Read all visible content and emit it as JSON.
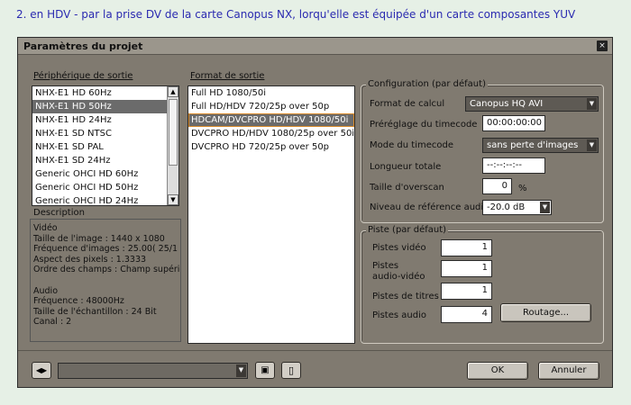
{
  "caption": "2. en HDV - par la prise DV de la carte Canopus NX, lorqu'elle est équipée d'un carte composantes YUV",
  "dialog": {
    "title": "Paramètres du projet",
    "close_glyph": "×"
  },
  "output_device": {
    "label": "Périphérique de sortie",
    "items": [
      {
        "label": "NHX-E1 HD 60Hz"
      },
      {
        "label": "NHX-E1 HD 50Hz"
      },
      {
        "label": "NHX-E1 HD 24Hz"
      },
      {
        "label": "NHX-E1 SD NTSC"
      },
      {
        "label": "NHX-E1 SD PAL"
      },
      {
        "label": "NHX-E1 SD 24Hz"
      },
      {
        "label": "Generic OHCI HD 60Hz"
      },
      {
        "label": "Generic OHCI HD 50Hz"
      },
      {
        "label": "Generic OHCI HD 24Hz"
      }
    ],
    "selected_index": 1
  },
  "output_format": {
    "label": "Format de sortie",
    "items": [
      {
        "label": "Full HD 1080/50i"
      },
      {
        "label": "Full HD/HDV 720/25p over 50p"
      },
      {
        "label": "HDCAM/DVCPRO HD/HDV 1080/50i"
      },
      {
        "label": "DVCPRO HD/HDV 1080/25p over 50i"
      },
      {
        "label": "DVCPRO HD 720/25p over 50p"
      }
    ],
    "selected_index": 2
  },
  "description": {
    "label": "Description",
    "lines": [
      "Vidéo",
      "Taille de l'image : 1440 x 1080",
      "Fréquence d'images : 25.00( 25/1",
      " Aspect des pixels : 1.3333",
      "Ordre des champs : Champ supérie",
      "",
      "Audio",
      "Fréquence : 48000Hz",
      "Taille de l'échantillon : 24 Bit",
      " Canal : 2"
    ]
  },
  "config": {
    "title": "Configuration (par défaut)",
    "format_calc_label": "Format de calcul",
    "format_calc_value": "Canopus HQ AVI",
    "timecode_preset_label": "Préréglage du timecode",
    "timecode_preset_value": "00:00:00:00",
    "timecode_mode_label": "Mode du timecode",
    "timecode_mode_value": "sans perte d'images",
    "total_length_label": "Longueur totale",
    "total_length_value": "--:--:--:--",
    "overscan_label": "Taille d'overscan",
    "overscan_value": "0",
    "overscan_unit": "%",
    "audio_ref_label": "Niveau de référence audio",
    "audio_ref_value": "-20.0 dB"
  },
  "track": {
    "title": "Piste (par défaut)",
    "video_label": "Pistes vidéo",
    "video_value": "1",
    "audio_video_label_1": "Pistes",
    "audio_video_label_2": "audio-vidéo",
    "audio_video_value": "1",
    "titles_label": "Pistes de titres",
    "titles_value": "1",
    "audio_label": "Pistes audio",
    "audio_value": "4",
    "routing_label": "Routage..."
  },
  "footer": {
    "ok_label": "OK",
    "cancel_label": "Annuler",
    "nav_glyph": "◀▶",
    "save_glyph": "▣",
    "delete_glyph": "▯"
  }
}
